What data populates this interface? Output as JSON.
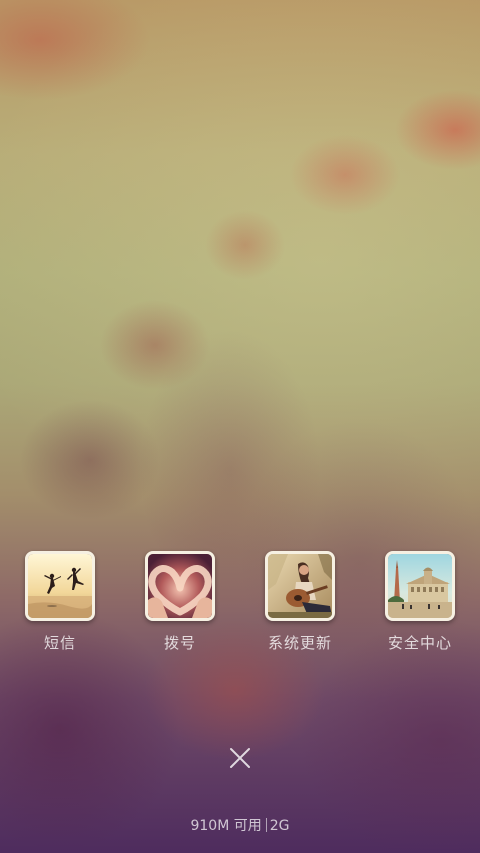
{
  "recent_apps": [
    {
      "label": "短信",
      "icon": "sms-photo-icon"
    },
    {
      "label": "拨号",
      "icon": "dialer-photo-icon"
    },
    {
      "label": "系统更新",
      "icon": "system-update-photo-icon"
    },
    {
      "label": "安全中心",
      "icon": "security-center-photo-icon"
    }
  ],
  "close_icon": "close-icon",
  "memory": {
    "available": "910M 可用",
    "total": "2G"
  }
}
